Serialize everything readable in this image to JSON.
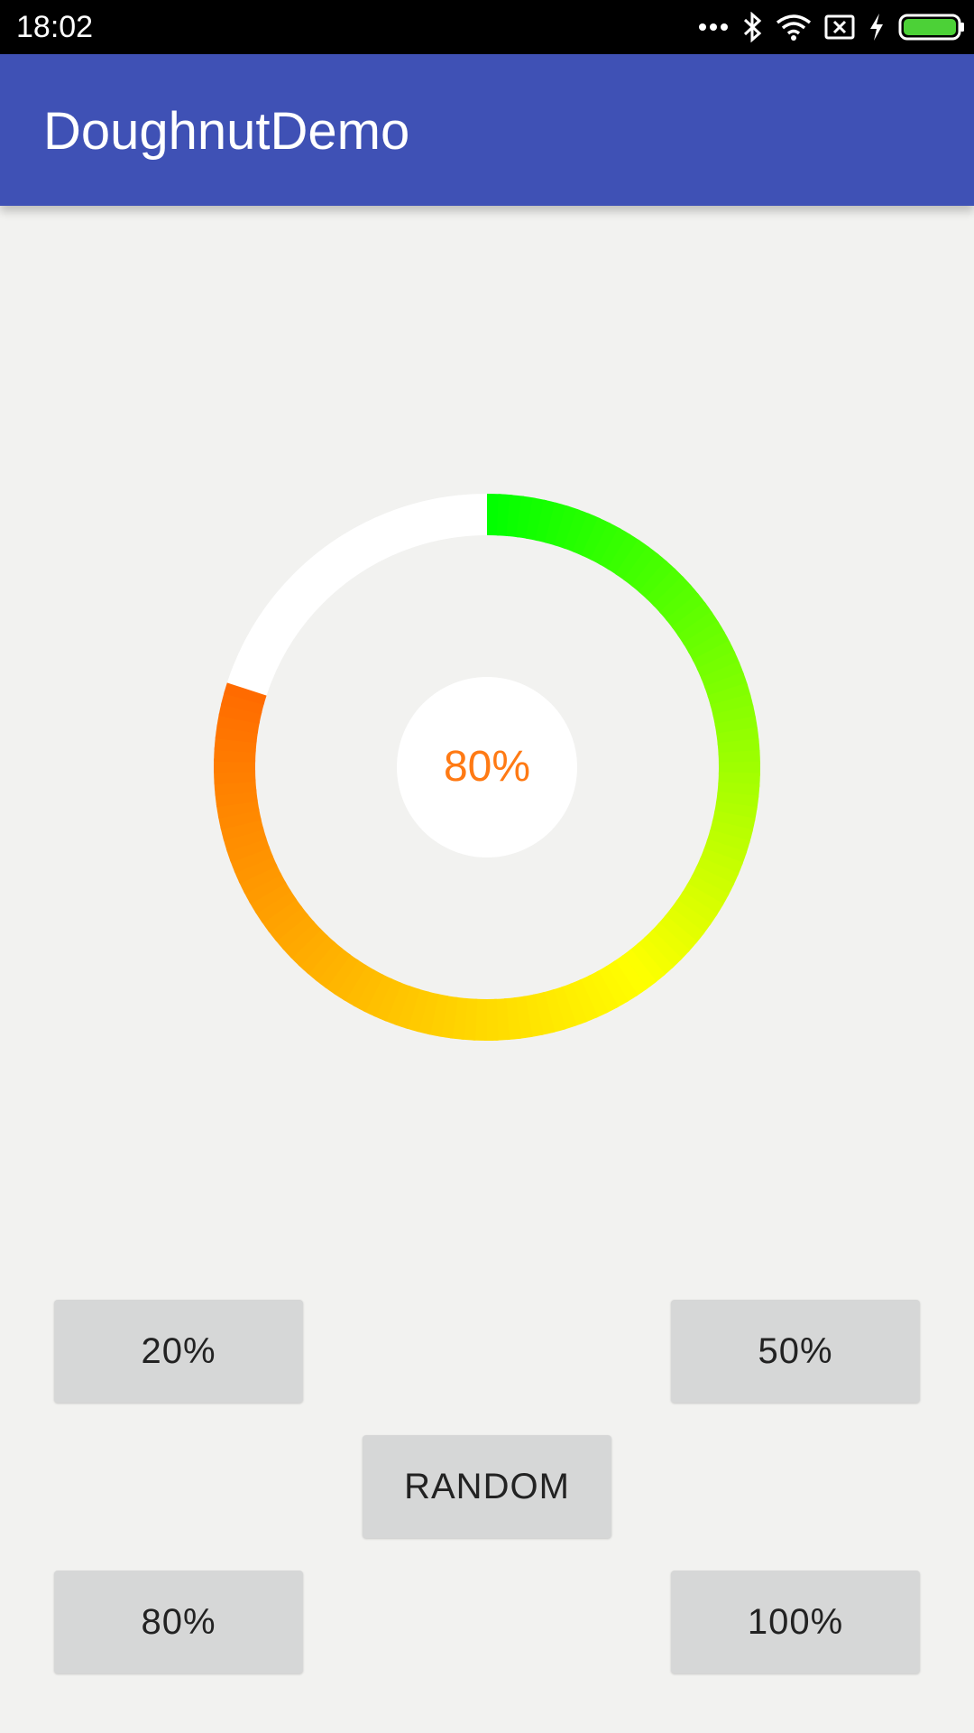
{
  "status_bar": {
    "time": "18:02",
    "icons": [
      "more-dots-icon",
      "bluetooth-icon",
      "wifi-icon",
      "no-sim-icon",
      "charging-icon",
      "battery-icon"
    ]
  },
  "app_bar": {
    "title": "DoughnutDemo",
    "color": "#3f51b5"
  },
  "doughnut": {
    "progress": 0.8,
    "label": "80%",
    "label_color": "#ff7a14",
    "track_color": "#ffffff",
    "gradient_colors": [
      "#ff6a00",
      "#ffff00",
      "#00ff00"
    ]
  },
  "buttons": {
    "b20": "20%",
    "b50": "50%",
    "random": "RANDOM",
    "b80": "80%",
    "b100": "100%"
  }
}
